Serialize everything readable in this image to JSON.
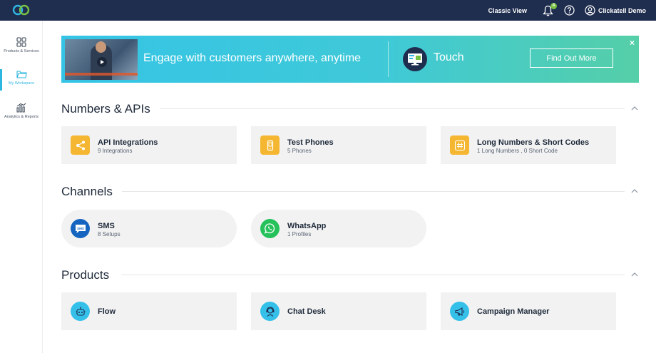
{
  "header": {
    "classic_view": "Classic View",
    "notification_count": "4",
    "account_name": "Clickatell Demo"
  },
  "sidebar": {
    "items": [
      {
        "label": "Products & Services",
        "icon": "grid-icon"
      },
      {
        "label": "My Workspace",
        "icon": "folder-icon",
        "active": true
      },
      {
        "label": "Analytics & Reports",
        "icon": "bar-chart-icon"
      }
    ]
  },
  "banner": {
    "headline": "Engage with customers anywhere, anytime",
    "product": "Touch",
    "cta": "Find Out More",
    "close": "×"
  },
  "sections": {
    "numbers": {
      "title": "Numbers & APIs",
      "cards": [
        {
          "title": "API Integrations",
          "subtitle": "9 Integrations",
          "icon": "share-icon"
        },
        {
          "title": "Test Phones",
          "subtitle": "5 Phones",
          "icon": "phone-icon"
        },
        {
          "title": "Long Numbers & Short Codes",
          "subtitle": "1 Long Numbers , 0 Short Code",
          "icon": "hash-icon"
        }
      ]
    },
    "channels": {
      "title": "Channels",
      "cards": [
        {
          "title": "SMS",
          "subtitle": "8 Setups",
          "icon": "sms-icon",
          "icon_text": "SMS"
        },
        {
          "title": "WhatsApp",
          "subtitle": "1 Profiles",
          "icon": "whatsapp-icon"
        }
      ]
    },
    "products": {
      "title": "Products",
      "cards": [
        {
          "title": "Flow",
          "icon": "robot-icon"
        },
        {
          "title": "Chat Desk",
          "icon": "chat-agent-icon"
        },
        {
          "title": "Campaign Manager",
          "icon": "megaphone-icon"
        }
      ]
    }
  },
  "colors": {
    "topbar": "#1f2d4f",
    "accent": "#2fb6e0",
    "icon_yellow": "#f5b731",
    "sms_blue": "#1565c0",
    "whatsapp_green": "#25c15a",
    "product_cyan": "#35c0ea"
  }
}
